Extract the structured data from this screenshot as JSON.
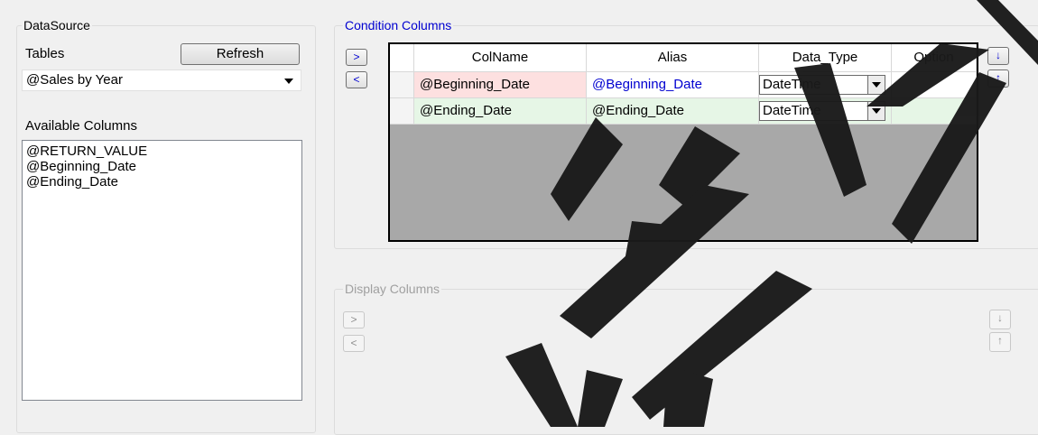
{
  "datasource": {
    "legend": "DataSource",
    "tables_label": "Tables",
    "refresh_label": "Refresh",
    "selected_table": "@Sales by Year",
    "available_label": "Available Columns",
    "available_columns": [
      "@RETURN_VALUE",
      "@Beginning_Date",
      "@Ending_Date"
    ]
  },
  "condition": {
    "legend": "Condition Columns",
    "add_label": ">",
    "remove_label": "<",
    "down_label": "↓",
    "up_label": "↑",
    "headers": [
      "ColName",
      "Alias",
      "Data_Type",
      "Option"
    ],
    "rows": [
      {
        "colname": "@Beginning_Date",
        "alias": "@Beginning_Date",
        "data_type": "DateTime",
        "option": ""
      },
      {
        "colname": "@Ending_Date",
        "alias": "@Ending_Date",
        "data_type": "DateTime",
        "option": ""
      }
    ]
  },
  "display": {
    "legend": "Display Columns",
    "add_label": ">",
    "remove_label": "<",
    "down_label": "↓",
    "up_label": "↑"
  },
  "colors": {
    "row1_bg": "#fde0e0",
    "row2_bg": "#e6f6e6",
    "selected_alias": "#0000d0",
    "grid_empty": "#a8a8a8"
  }
}
